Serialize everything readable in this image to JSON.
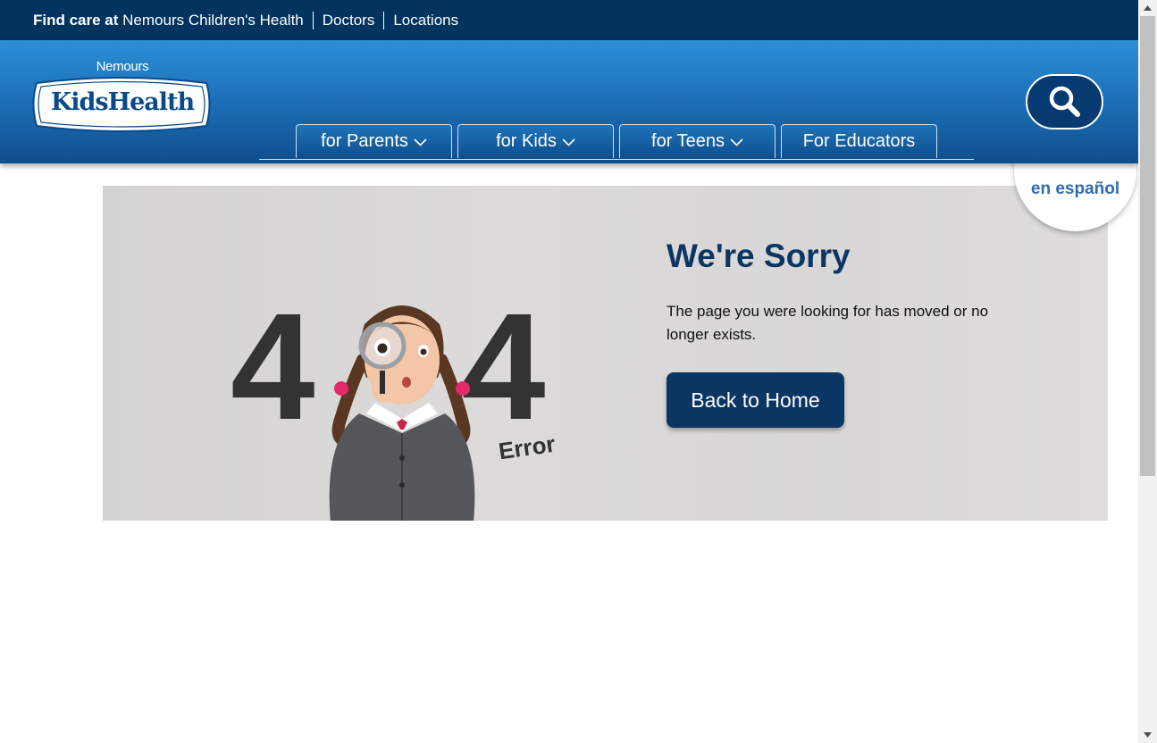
{
  "topbar": {
    "find_bold": "Find care at",
    "find_link": "Nemours Children's Health",
    "doctors": "Doctors",
    "locations": "Locations"
  },
  "logo": {
    "brand_top": "Nemours",
    "brand_main": "KidsHealth"
  },
  "nav": {
    "tabs": [
      {
        "label": "for Parents",
        "has_dropdown": true
      },
      {
        "label": "for Kids",
        "has_dropdown": true
      },
      {
        "label": "for Teens",
        "has_dropdown": true
      },
      {
        "label": "For Educators",
        "has_dropdown": false
      }
    ]
  },
  "language": {
    "label": "en español"
  },
  "error": {
    "digit_left": "4",
    "digit_right": "4",
    "error_word": "Error",
    "title": "We're Sorry",
    "message": "The page you were looking for has moved or no longer exists.",
    "button": "Back to Home"
  },
  "colors": {
    "topbar_bg": "#01335f",
    "header_blue": "#1b6cb4",
    "title_navy": "#0b3563",
    "espanol_blue": "#2f6db0"
  }
}
